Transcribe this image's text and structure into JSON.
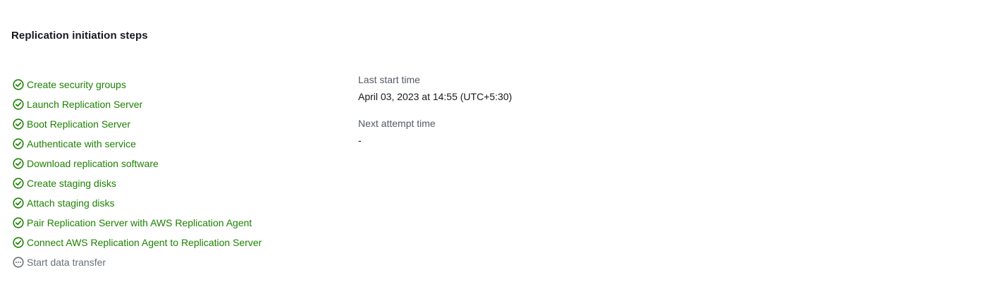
{
  "section": {
    "title": "Replication initiation steps"
  },
  "steps": [
    {
      "label": "Create security groups",
      "status": "success"
    },
    {
      "label": "Launch Replication Server",
      "status": "success"
    },
    {
      "label": "Boot Replication Server",
      "status": "success"
    },
    {
      "label": "Authenticate with service",
      "status": "success"
    },
    {
      "label": "Download replication software",
      "status": "success"
    },
    {
      "label": "Create staging disks",
      "status": "success"
    },
    {
      "label": "Attach staging disks",
      "status": "success"
    },
    {
      "label": "Pair Replication Server with AWS Replication Agent",
      "status": "success"
    },
    {
      "label": "Connect AWS Replication Agent to Replication Server",
      "status": "success"
    },
    {
      "label": "Start data transfer",
      "status": "pending"
    }
  ],
  "details": {
    "last_start_time_label": "Last start time",
    "last_start_time_value": "April 03, 2023 at 14:55 (UTC+5:30)",
    "next_attempt_time_label": "Next attempt time",
    "next_attempt_time_value": "-"
  },
  "colors": {
    "success": "#1d8102",
    "pending": "#687078",
    "text": "#16191f",
    "label": "#545b64"
  },
  "icons": {
    "success": "check-circle-icon",
    "pending": "ellipsis-circle-icon"
  }
}
